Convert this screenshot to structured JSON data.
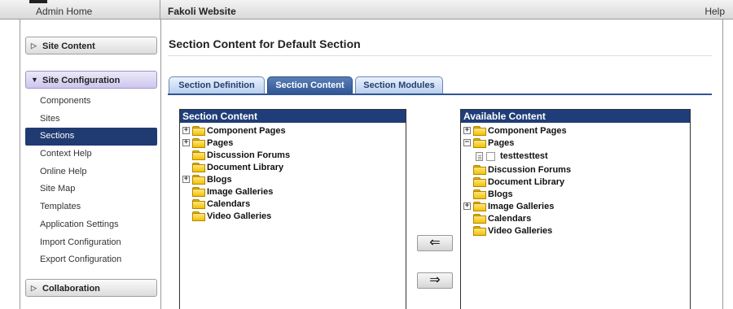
{
  "topbar": {
    "home": "Admin Home",
    "site": "Fakoli Website",
    "help": "Help"
  },
  "sidebar": {
    "site_content": "Site Content",
    "site_configuration": "Site Configuration",
    "collaboration": "Collaboration",
    "items": [
      {
        "label": "Components"
      },
      {
        "label": "Sites"
      },
      {
        "label": "Sections"
      },
      {
        "label": "Context Help"
      },
      {
        "label": "Online Help"
      },
      {
        "label": "Site Map"
      },
      {
        "label": "Templates"
      },
      {
        "label": "Application Settings"
      },
      {
        "label": "Import Configuration"
      },
      {
        "label": "Export Configuration"
      }
    ],
    "active_item": "Sections"
  },
  "main": {
    "title": "Section Content for Default Section",
    "tabs": [
      {
        "label": "Section Definition"
      },
      {
        "label": "Section Content"
      },
      {
        "label": "Section Modules"
      }
    ],
    "active_tab": "Section Content"
  },
  "section_content": {
    "header": "Section Content",
    "nodes": [
      {
        "label": "Component Pages",
        "expander": "+"
      },
      {
        "label": "Pages",
        "expander": "+"
      },
      {
        "label": "Discussion Forums",
        "expander": ""
      },
      {
        "label": "Document Library",
        "expander": ""
      },
      {
        "label": "Blogs",
        "expander": "+"
      },
      {
        "label": "Image Galleries",
        "expander": ""
      },
      {
        "label": "Calendars",
        "expander": ""
      },
      {
        "label": "Video Galleries",
        "expander": ""
      }
    ]
  },
  "available_content": {
    "header": "Available Content",
    "nodes": [
      {
        "label": "Component Pages",
        "expander": "+"
      },
      {
        "label": "Pages",
        "expander": "−"
      },
      {
        "label": "Discussion Forums",
        "expander": ""
      },
      {
        "label": "Document Library",
        "expander": ""
      },
      {
        "label": "Blogs",
        "expander": ""
      },
      {
        "label": "Image Galleries",
        "expander": "+"
      },
      {
        "label": "Calendars",
        "expander": ""
      },
      {
        "label": "Video Galleries",
        "expander": ""
      }
    ],
    "page_item": "testtesttest"
  },
  "buttons": {
    "move_left": "⇐",
    "move_right": "⇒"
  },
  "colors": {
    "accent": "#1f3d78",
    "active_tab": "#2f5594"
  }
}
